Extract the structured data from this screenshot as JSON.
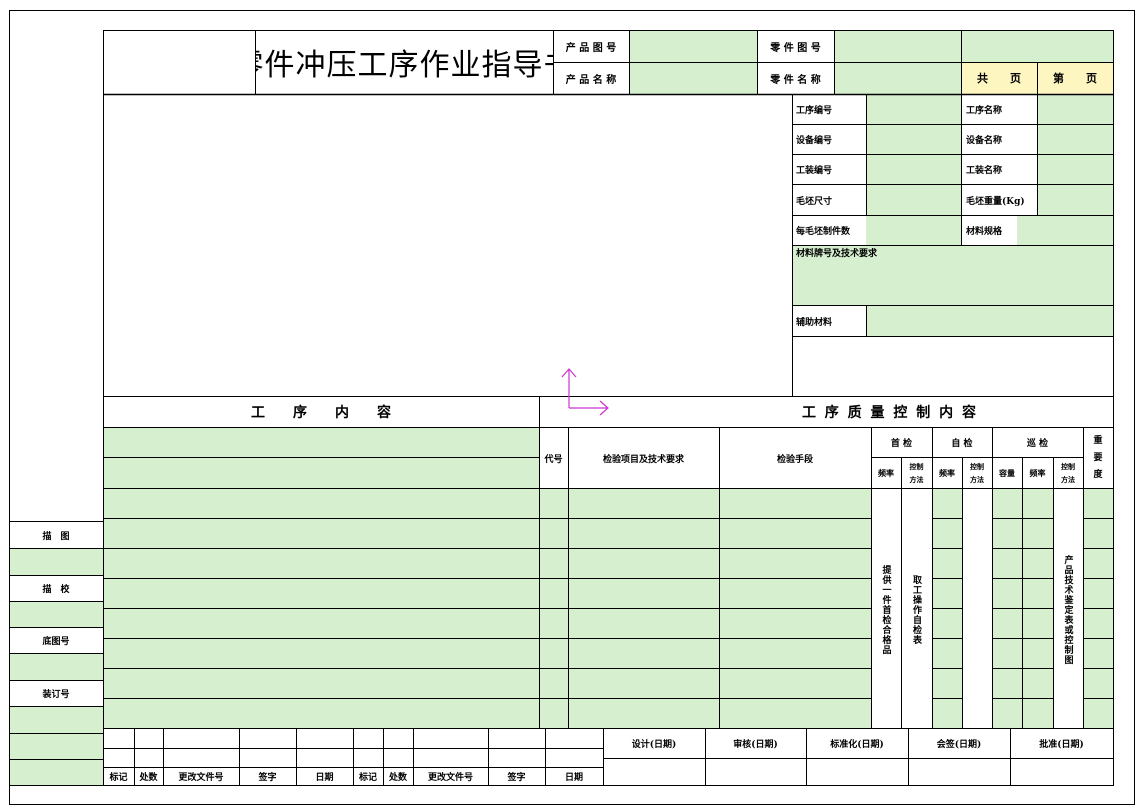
{
  "header": {
    "title": "零件冲压工序作业指导书",
    "product_drawing_no_label": "产 品 图 号",
    "product_name_label": "产 品 名 称",
    "part_drawing_no_label": "零 件 图 号",
    "part_name_label": "零 件 名 称",
    "total_pages_label": "共　　页",
    "page_no_label": "第　　页"
  },
  "info": {
    "process_no": "工序编号",
    "process_name": "工序名称",
    "equipment_no": "设备编号",
    "equipment_name": "设备名称",
    "tooling_no": "工装编号",
    "tooling_name": "工装名称",
    "blank_size": "毛坯尺寸",
    "blank_weight": "毛坯重量(Kg)",
    "parts_per_blank": "每毛坯制件数",
    "material_spec": "材料规格",
    "material_grade": "材料牌号及技术要求",
    "aux_material": "辅助材料"
  },
  "sections": {
    "process_content": "工　　序　　内　　容",
    "quality_control": "工 序 质 量 控 制 内 容"
  },
  "quality_table": {
    "code": "代号",
    "items": "检验项目及技术要求",
    "means": "检验手段",
    "first_check": "首 检",
    "self_check": "自 检",
    "patrol_check": "巡 检",
    "importance": "重要度",
    "frequency": "频率",
    "control_method": "控制方法",
    "capacity": "容量",
    "first_check_text": "提供一件首检合格品",
    "self_check_text": "取工操作自检表",
    "patrol_text": "产品技术鉴定表或控制图"
  },
  "side": {
    "drawn": "描　图",
    "traced": "描　校",
    "base_drawing_no": "底图号",
    "binding_no": "装订号"
  },
  "footer": {
    "mark": "标记",
    "count": "处数",
    "change_doc_no": "更改文件号",
    "signature": "签字",
    "date": "日期",
    "design": "设计(日期)",
    "review": "审核(日期)",
    "standardize": "标准化(日期)",
    "countersign": "会签(日期)",
    "approve": "批准(日期)"
  }
}
